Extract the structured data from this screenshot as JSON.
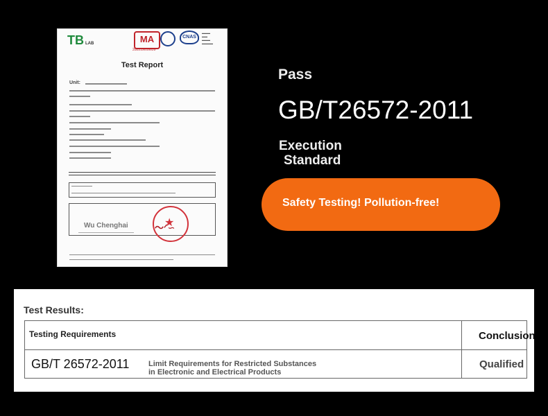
{
  "certificate": {
    "logo": "TB",
    "logo_sub": "LAB",
    "ma_mark": "MA",
    "ma_number": "202219016659",
    "cnas_mark": "CNAS",
    "title": "Test Report",
    "unit_label": "Unit:",
    "signature": "Wu Chenghai"
  },
  "headline": {
    "pass": "Pass",
    "standard_code": "GB/T26572-2011",
    "exec_line1": "Execution",
    "exec_line2": "Standard",
    "slogan": "Safety Testing! Pollution-free!"
  },
  "results": {
    "heading": "Test Results:",
    "col_requirements": "Testing Requirements",
    "col_conclusion": "Conclusion",
    "row_standard": "GB/T 26572-2011",
    "row_desc_line1": "Limit Requirements for Restricted Substances",
    "row_desc_line2": "in Electronic and Electrical Products",
    "row_conclusion": "Qualified"
  },
  "colors": {
    "accent_orange": "#f26a12",
    "background": "#000000",
    "seal_red": "#d2323a"
  }
}
